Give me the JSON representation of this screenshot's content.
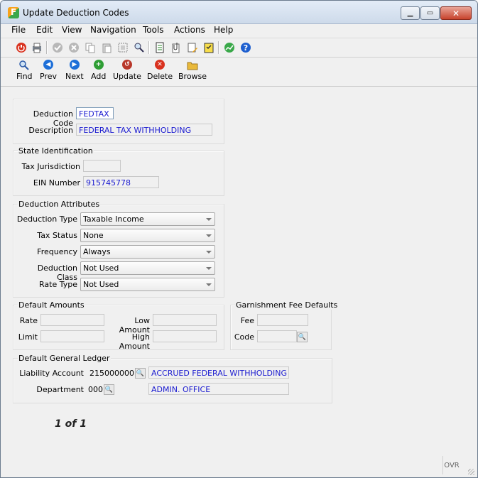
{
  "window": {
    "title": "Update Deduction Codes"
  },
  "menu": [
    "File",
    "Edit",
    "View",
    "Navigation",
    "Tools",
    "Actions",
    "Help"
  ],
  "toolbar_icons": [
    "exit-icon",
    "print-icon",
    "save-icon",
    "cancel-icon",
    "copy-icon",
    "paste-icon",
    "select-icon",
    "zoom-icon",
    "report-icon",
    "attach-icon",
    "notes-icon",
    "checklist-icon",
    "chart-icon",
    "help-icon"
  ],
  "actions": {
    "find": "Find",
    "prev": "Prev",
    "next": "Next",
    "add": "Add",
    "update": "Update",
    "delete": "Delete",
    "browse": "Browse"
  },
  "header": {
    "deduction_code_label": "Deduction Code",
    "deduction_code": "FEDTAX",
    "description_label": "Description",
    "description": "FEDERAL TAX WITHHOLDING"
  },
  "state": {
    "title": "State Identification",
    "tax_jurisdiction_label": "Tax Jurisdiction",
    "tax_jurisdiction": "",
    "ein_label": "EIN Number",
    "ein": "915745778"
  },
  "attributes": {
    "title": "Deduction Attributes",
    "deduction_type_label": "Deduction Type",
    "deduction_type": "Taxable Income",
    "tax_status_label": "Tax Status",
    "tax_status": "None",
    "frequency_label": "Frequency",
    "frequency": "Always",
    "deduction_class_label": "Deduction Class",
    "deduction_class": "Not Used",
    "rate_type_label": "Rate Type",
    "rate_type": "Not Used"
  },
  "defaults": {
    "title": "Default Amounts",
    "rate_label": "Rate",
    "limit_label": "Limit",
    "low_label": "Low Amount",
    "high_label": "High Amount"
  },
  "garnish": {
    "title": "Garnishment Fee Defaults",
    "fee_label": "Fee",
    "code_label": "Code"
  },
  "gl": {
    "title": "Default General Ledger",
    "liability_label": "Liability Account",
    "liability": "215000000",
    "liability_desc": "ACCRUED FEDERAL WITHHOLDING",
    "department_label": "Department",
    "department": "000",
    "department_desc": "ADMIN. OFFICE"
  },
  "record_count": "1 of 1",
  "status": {
    "mode": "OVR"
  },
  "colors": {
    "value_text": "#1a1ad0",
    "title_bar": "#cddaea"
  }
}
